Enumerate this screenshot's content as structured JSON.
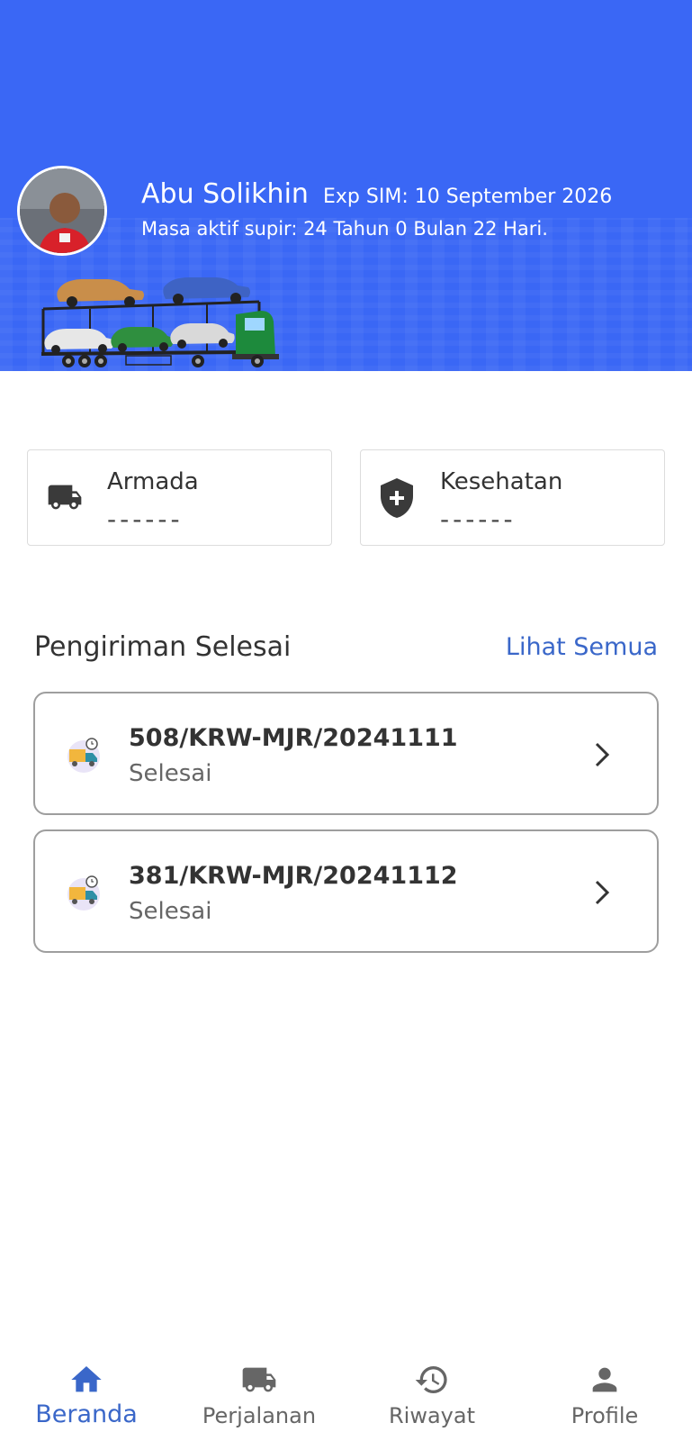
{
  "theme": {
    "primary": "#3a67f5",
    "link": "#3a67c9"
  },
  "header": {
    "name": "Abu Solikhin",
    "exp_sim": "Exp SIM: 10 September 2026",
    "masa_aktif": "Masa aktif supir: 24 Tahun 0 Bulan 22 Hari."
  },
  "cards": {
    "armada": {
      "title": "Armada",
      "value": "------",
      "icon": "truck-icon"
    },
    "kesehatan": {
      "title": "Kesehatan",
      "value": "------",
      "icon": "shield-plus-icon"
    }
  },
  "section": {
    "title": "Pengiriman Selesai",
    "see_all": "Lihat Semua"
  },
  "deliveries": [
    {
      "code": "508/KRW-MJR/20241111",
      "status": "Selesai"
    },
    {
      "code": "381/KRW-MJR/20241112",
      "status": "Selesai"
    }
  ],
  "nav": [
    {
      "label": "Beranda",
      "icon": "home-icon",
      "active": true
    },
    {
      "label": "Perjalanan",
      "icon": "truck-icon",
      "active": false
    },
    {
      "label": "Riwayat",
      "icon": "history-icon",
      "active": false
    },
    {
      "label": "Profile",
      "icon": "person-icon",
      "active": false
    }
  ]
}
